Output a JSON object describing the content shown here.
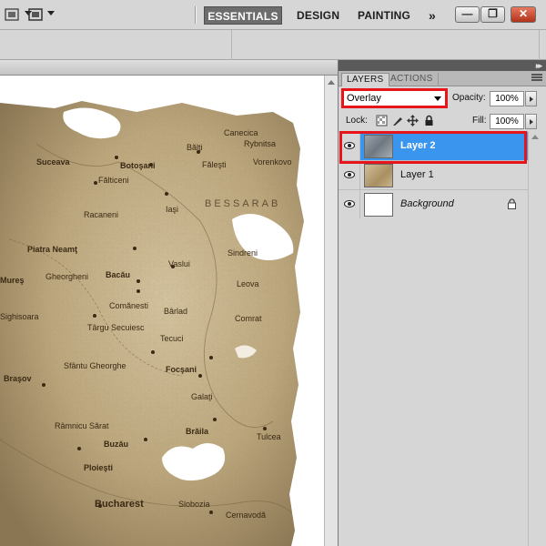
{
  "toolbar": {
    "icons": [
      "hand-tool-icon",
      "zoom-dropdown-icon",
      "screen-mode-icon"
    ],
    "workspaces": {
      "essentials": "ESSENTIALS",
      "design": "DESIGN",
      "painting": "PAINTING",
      "more": "»"
    },
    "window_buttons": {
      "minimize": "—",
      "restore": "❐",
      "close": "✕"
    }
  },
  "document": {
    "map_cities": [
      "Suceava",
      "Botoşani",
      "Bălţi",
      "Canecica",
      "Rybnitsa",
      "Făleşti",
      "Vorenkovo",
      "Fălticeni",
      "Racaneni",
      "Iaşi",
      "BESSARAB",
      "Piatra Neamţ",
      "Vaslui",
      "Sindreni",
      "Mureş",
      "Gheorgheni",
      "Bacău",
      "Leova",
      "Sighisoara",
      "Comănesti",
      "Bârlad",
      "Târgu Secuiesc",
      "Tecuci",
      "Comrat",
      "Braşov",
      "Sfântu Gheorghe",
      "Focşani",
      "Galaţi",
      "Râmnicu Sărat",
      "Buzău",
      "Brăila",
      "Tulcea",
      "Ploieşti",
      "Bucharest",
      "Slobozia",
      "Cernavodă"
    ]
  },
  "colors": {
    "selected_layer": "#3a95ef",
    "highlight_box": "#e8141c",
    "panel_bg": "#d6d6d6",
    "map_sepia": "#c8b48e"
  },
  "panel": {
    "tabs": [
      "LAYERS",
      "ACTIONS"
    ],
    "blend_mode": "Overlay",
    "opacity_label": "Opacity:",
    "opacity_value": "100%",
    "lock_label": "Lock:",
    "fill_label": "Fill:",
    "fill_value": "100%",
    "layers": [
      {
        "name": "Layer 2",
        "visible": true,
        "selected": true
      },
      {
        "name": "Layer 1",
        "visible": true,
        "selected": false
      },
      {
        "name": "Background",
        "visible": true,
        "selected": false,
        "locked": true
      }
    ]
  }
}
